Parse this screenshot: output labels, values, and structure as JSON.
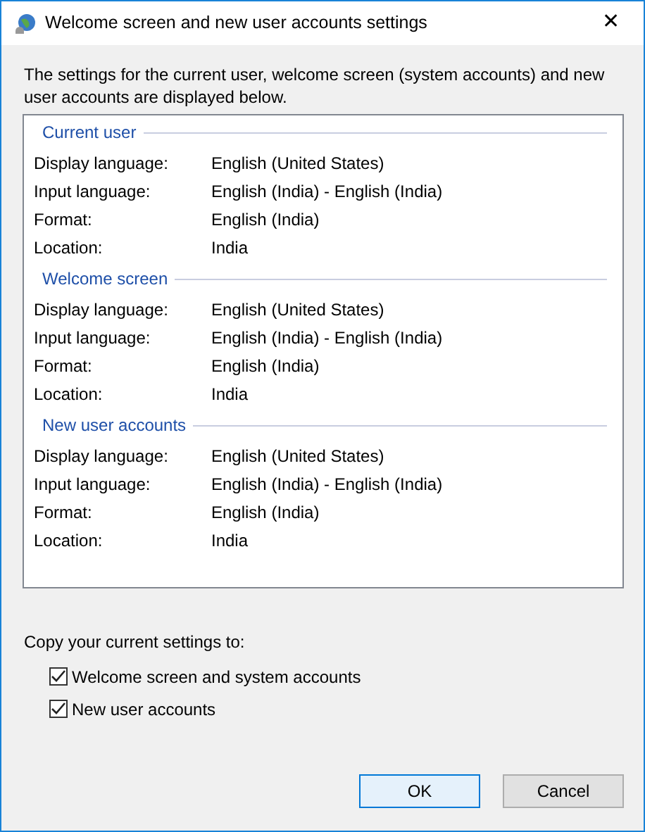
{
  "window": {
    "title": "Welcome screen and new user accounts settings",
    "close": "✕"
  },
  "intro": "The settings for the current user, welcome screen (system accounts) and new user accounts are displayed below.",
  "sections": [
    {
      "title": "Current user",
      "rows": [
        {
          "label": "Display language:",
          "value": "English (United States)"
        },
        {
          "label": "Input language:",
          "value": "English (India) - English (India)"
        },
        {
          "label": "Format:",
          "value": "English (India)"
        },
        {
          "label": "Location:",
          "value": "India"
        }
      ]
    },
    {
      "title": "Welcome screen",
      "rows": [
        {
          "label": "Display language:",
          "value": "English (United States)"
        },
        {
          "label": "Input language:",
          "value": "English (India) - English (India)"
        },
        {
          "label": "Format:",
          "value": "English (India)"
        },
        {
          "label": "Location:",
          "value": "India"
        }
      ]
    },
    {
      "title": "New user accounts",
      "rows": [
        {
          "label": "Display language:",
          "value": "English (United States)"
        },
        {
          "label": "Input language:",
          "value": "English (India) - English (India)"
        },
        {
          "label": "Format:",
          "value": "English (India)"
        },
        {
          "label": "Location:",
          "value": "India"
        }
      ]
    }
  ],
  "copy": {
    "label": "Copy your current settings to:",
    "options": [
      {
        "label": "Welcome screen and system accounts",
        "checked": true
      },
      {
        "label": "New user accounts",
        "checked": true
      }
    ]
  },
  "buttons": [
    {
      "label": "OK",
      "kind": "default"
    },
    {
      "label": "Cancel",
      "kind": "normal"
    }
  ]
}
